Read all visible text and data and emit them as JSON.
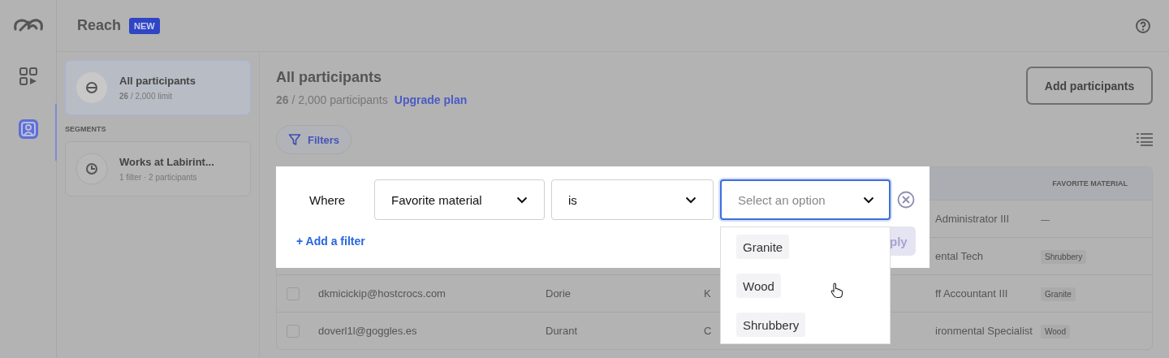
{
  "header": {
    "title": "Reach",
    "badge": "NEW"
  },
  "nav": [
    {
      "selected": false
    },
    {
      "selected": true
    }
  ],
  "sidebar": {
    "items": [
      {
        "title": "All participants",
        "subtitle": "**26** / 2,000 limit",
        "selected": true
      }
    ],
    "section_label": "SEGMENTS",
    "segments": [
      {
        "title": "Works at Labirint...",
        "subtitle": "1 filter · 2 participants",
        "selected": false
      }
    ]
  },
  "main": {
    "title": "All participants",
    "count": "**26** / 2,000 participants",
    "upgrade_link": "Upgrade plan",
    "add_button": "Add participants",
    "filters_button": "Filters"
  },
  "table": {
    "columns": [
      "FAVORITE MATERIAL"
    ],
    "rows": [
      {
        "title": "Administrator III",
        "material": "—"
      },
      {
        "title": "ental Tech",
        "material": "Shrubbery"
      },
      {
        "checked": false,
        "email": "dkmicickip@hostcrocs.com",
        "first_name": "Dorie",
        "column_3": "K",
        "title": "ff Accountant III",
        "material": "Granite"
      },
      {
        "checked": false,
        "email": "doverl1l@goggles.es",
        "first_name": "Durant",
        "column_3": "C",
        "title": "ironmental Specialist",
        "material": "Wood"
      }
    ]
  },
  "filter_panel": {
    "where": "Where",
    "field": "Favorite material",
    "operator": "is",
    "value": {
      "placeholder": "Select an option",
      "open": true
    },
    "add_filter": "+ Add a filter",
    "apply_button": "ply",
    "options": [
      "Granite",
      "Wood",
      "Shrubbery"
    ]
  }
}
